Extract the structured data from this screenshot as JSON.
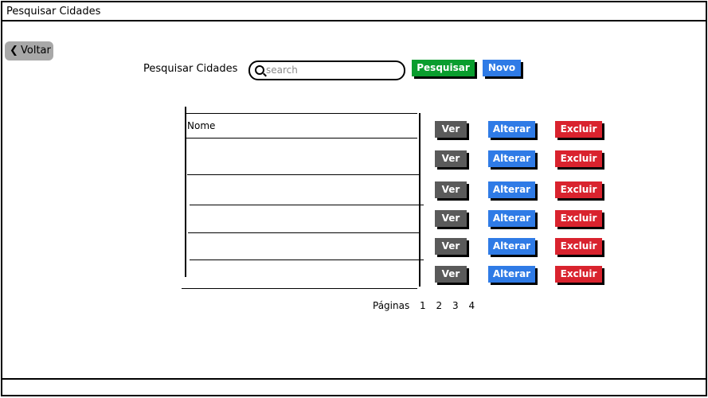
{
  "window": {
    "title": "Pesquisar Cidades"
  },
  "nav": {
    "back_label": "Voltar"
  },
  "search": {
    "label": "Pesquisar Cidades",
    "placeholder": "search",
    "value": "",
    "search_button": "Pesquisar",
    "new_button": "Novo"
  },
  "table": {
    "column_header": "Nome",
    "rows": [
      "",
      "",
      "",
      "",
      ""
    ]
  },
  "row_actions": {
    "view": "Ver",
    "edit": "Alterar",
    "delete": "Excluir"
  },
  "pagination": {
    "label": "Páginas",
    "pages": [
      "1",
      "2",
      "3",
      "4"
    ]
  },
  "colors": {
    "view": "#5a5a5a",
    "edit": "#2f7be6",
    "delete": "#d9232e",
    "search": "#0a9d2e",
    "new": "#2f7be6",
    "back": "#a8a8a8"
  }
}
